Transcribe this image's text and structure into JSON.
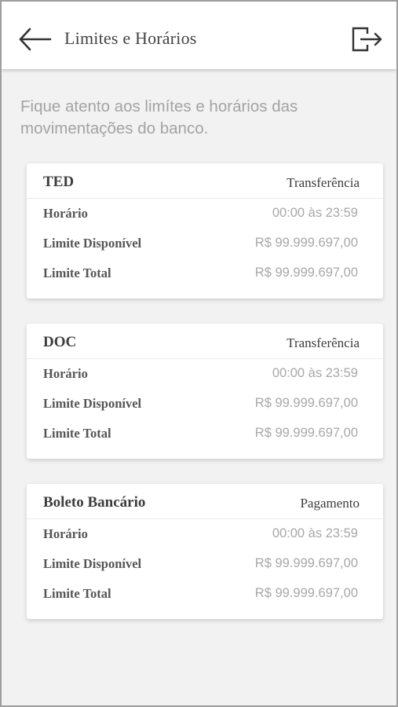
{
  "header": {
    "title": "Limites e Horários",
    "back_icon": "arrow-left-icon",
    "logout_icon": "logout-icon"
  },
  "intro_text": "Fique atento aos limítes e horários das movimentações do banco.",
  "cards": [
    {
      "name": "TED",
      "type": "Transferência",
      "rows": [
        {
          "label": "Horário",
          "value": "00:00 às 23:59"
        },
        {
          "label": "Limite Disponível",
          "value": "R$ 99.999.697,00"
        },
        {
          "label": "Limite Total",
          "value": "R$ 99.999.697,00"
        }
      ]
    },
    {
      "name": "DOC",
      "type": "Transferência",
      "rows": [
        {
          "label": "Horário",
          "value": "00:00 às 23:59"
        },
        {
          "label": "Limite Disponível",
          "value": "R$ 99.999.697,00"
        },
        {
          "label": "Limite Total",
          "value": "R$ 99.999.697,00"
        }
      ]
    },
    {
      "name": "Boleto Bancário",
      "type": "Pagamento",
      "rows": [
        {
          "label": "Horário",
          "value": "00:00 às 23:59"
        },
        {
          "label": "Limite Disponível",
          "value": "R$ 99.999.697,00"
        },
        {
          "label": "Limite Total",
          "value": "R$ 99.999.697,00"
        }
      ]
    }
  ],
  "colors": {
    "header_bg": "#ffffff",
    "page_bg": "#f2f2f2",
    "text_dark": "#3d3d3d",
    "text_muted": "#a8a8a8"
  }
}
